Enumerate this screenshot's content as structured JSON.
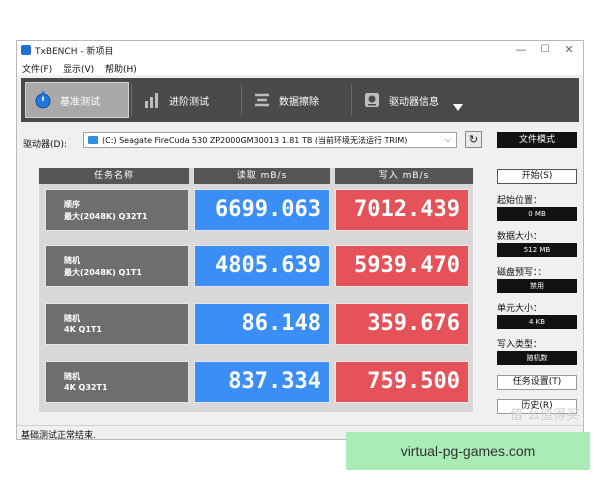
{
  "window": {
    "title": "TxBENCH - 新项目",
    "controls": {
      "minimize": "—",
      "maximize": "☐",
      "close": "✕"
    }
  },
  "menubar": {
    "items": [
      "文件(F)",
      "显示(V)",
      "帮助(H)"
    ]
  },
  "toolbar": {
    "items": [
      {
        "label": "基准测试",
        "icon": "stopwatch-icon",
        "active": true
      },
      {
        "label": "进阶测试",
        "icon": "bar-chart-icon",
        "active": false
      },
      {
        "label": "数据擦除",
        "icon": "erase-icon",
        "active": false
      },
      {
        "label": "驱动器信息",
        "icon": "drive-info-icon",
        "active": false
      }
    ],
    "more_icon": "dropdown-arrow-icon"
  },
  "drive": {
    "label": "驱动器(D):",
    "selected": "(C:) Seagate FireCuda 530 ZP2000GM30013  1.81 TB (当前环境无法运行 TRIM)",
    "refresh_icon": "refresh-icon",
    "file_mode_label": "文件模式"
  },
  "table": {
    "headers": [
      "任务名称",
      "读取 mB/s",
      "写入 mB/s"
    ],
    "rows": [
      {
        "name_line1": "顺序",
        "name_line2": "最大(2048K) Q32T1",
        "read": "6699.063",
        "write": "7012.439"
      },
      {
        "name_line1": "随机",
        "name_line2": "最大(2048K) Q1T1",
        "read": "4805.639",
        "write": "5939.470"
      },
      {
        "name_line1": "随机",
        "name_line2": "4K Q1T1",
        "read": "86.148",
        "write": "359.676"
      },
      {
        "name_line1": "随机",
        "name_line2": "4K Q32T1",
        "read": "837.334",
        "write": "759.500"
      }
    ]
  },
  "side_panel": {
    "start_label": "开始(S)",
    "fields": [
      {
        "label": "起始位置：",
        "value": "0 MB"
      },
      {
        "label": "数据大小：",
        "value": "512 MB"
      },
      {
        "label": "磁盘预写：：",
        "value": "禁用"
      },
      {
        "label": "单元大小：",
        "value": "4 KB"
      },
      {
        "label": "写入类型：",
        "value": "随机数"
      }
    ],
    "task_settings_label": "任务设置(T)",
    "history_label": "历史(R)"
  },
  "status": {
    "text": "基础测试正常结束."
  },
  "overlay": {
    "watermark": "值 么值得买",
    "banner_text": "virtual-pg-games.com"
  },
  "colors": {
    "read": "#3b8ef5",
    "write": "#e5525a",
    "toolbar": "#4a4a4a",
    "banner": "#a9ecb5"
  }
}
